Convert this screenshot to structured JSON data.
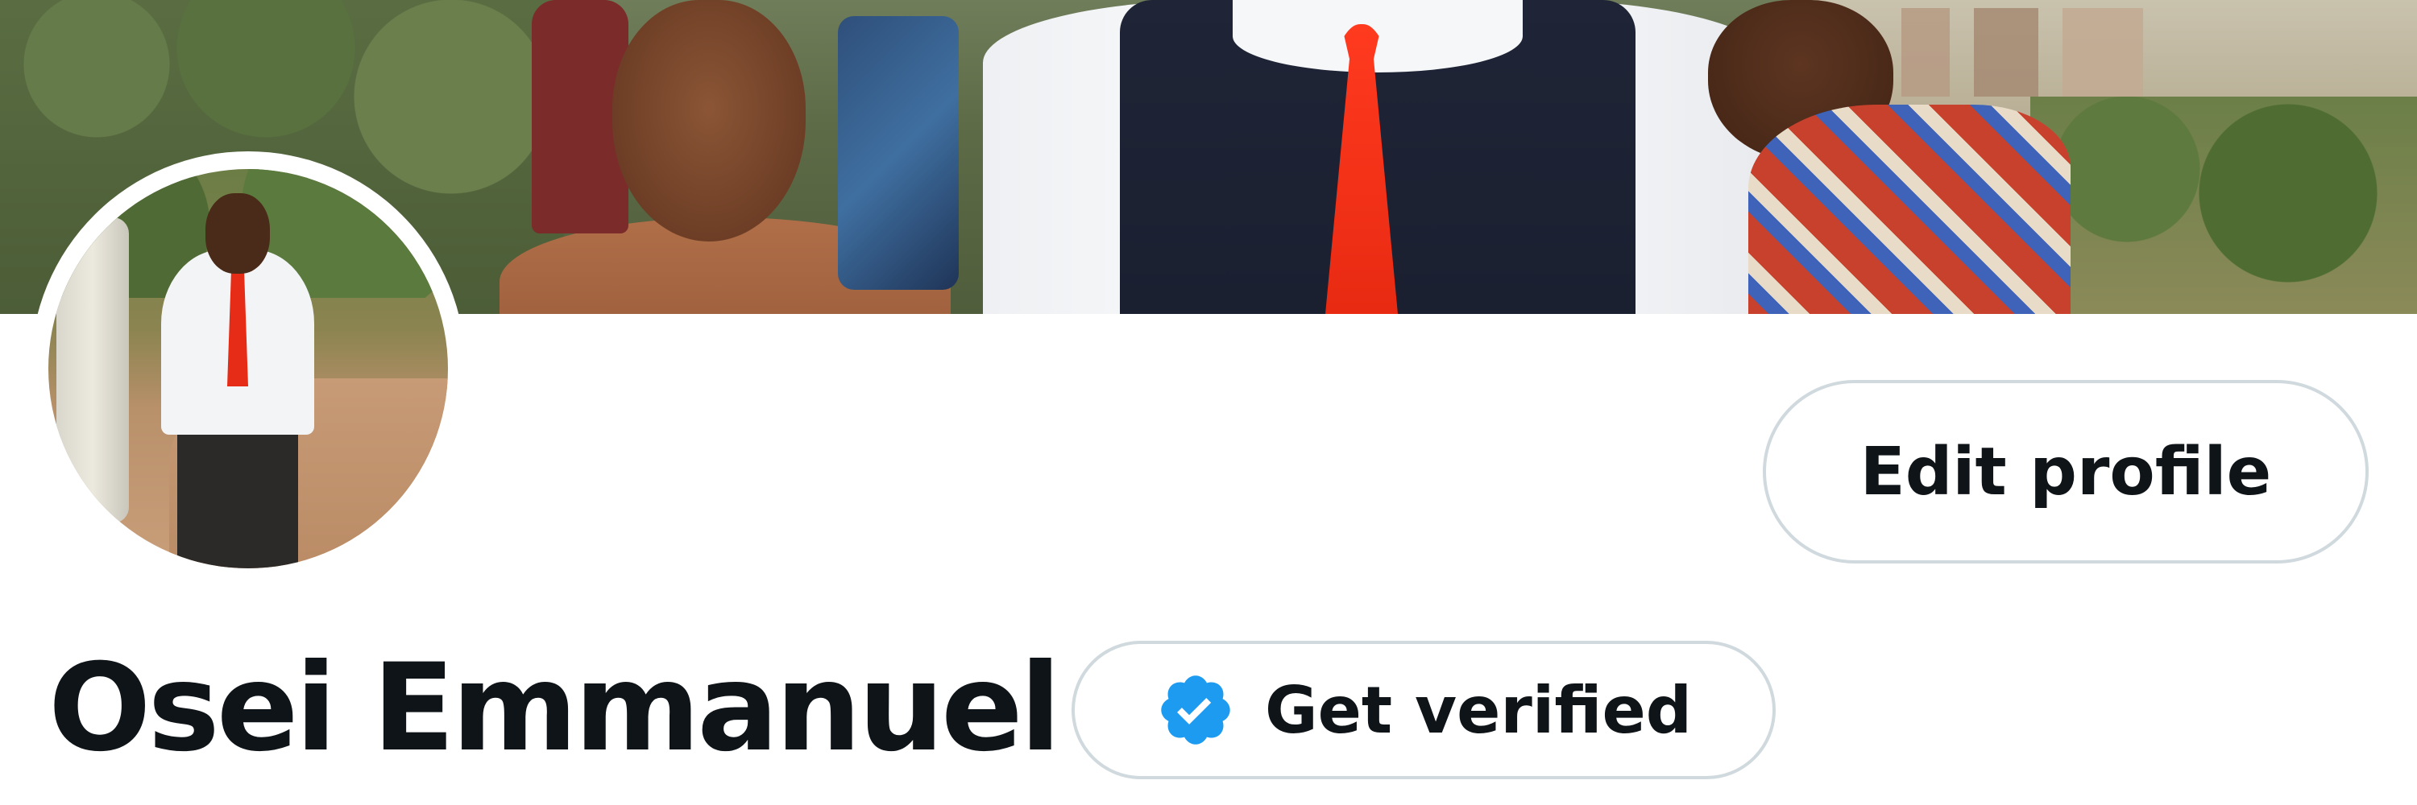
{
  "profile": {
    "display_name": "Osei Emmanuel",
    "edit_profile_label": "Edit profile",
    "get_verified_label": "Get verified"
  },
  "icons": {
    "verified_badge": "verified-badge-icon"
  },
  "colors": {
    "verified_blue": "#1d9bf0",
    "text_primary": "#0f1419",
    "button_border": "#cfd9de",
    "background": "#ffffff"
  }
}
